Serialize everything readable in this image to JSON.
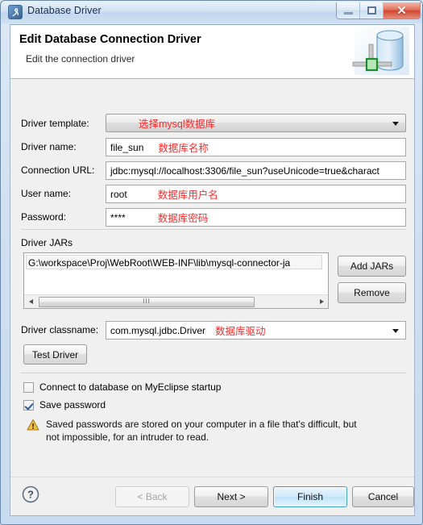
{
  "window": {
    "title": "Database Driver",
    "title_icon": "database-driver-icon",
    "controls": {
      "minimize": "minimize-icon",
      "maximize": "maximize-icon",
      "close": "close-icon"
    }
  },
  "banner": {
    "title": "Edit Database Connection Driver",
    "subtitle": "Edit the connection driver",
    "icon": "database-cylinder-icon"
  },
  "form": {
    "driver_template": {
      "label": "Driver template:",
      "value": "",
      "annotation": "选择mysql数据库"
    },
    "driver_name": {
      "label": "Driver name:",
      "value": "file_sun",
      "annotation": "数据库名称"
    },
    "connection_url": {
      "label": "Connection URL:",
      "value": "jdbc:mysql://localhost:3306/file_sun?useUnicode=true&charact",
      "annotation": ""
    },
    "user_name": {
      "label": "User name:",
      "value": "root",
      "annotation": "数据库用户名"
    },
    "password": {
      "label": "Password:",
      "value": "****",
      "annotation": "数据库密码"
    }
  },
  "driver_jars": {
    "section_label": "Driver JARs",
    "items": [
      "G:\\workspace\\Proj\\WebRoot\\WEB-INF\\lib\\mysql-connector-ja"
    ],
    "add_button": "Add JARs",
    "remove_button": "Remove",
    "scrollbar_grip": "III"
  },
  "driver_classname": {
    "label": "Driver classname:",
    "value": "com.mysql.jdbc.Driver",
    "annotation": "数据库驱动"
  },
  "test_driver_button": "Test Driver",
  "options": {
    "connect_on_startup": {
      "label": "Connect to database on MyEclipse startup",
      "checked": false
    },
    "save_password": {
      "label": "Save password",
      "checked": true
    }
  },
  "warning": {
    "icon": "warning-triangle-icon",
    "text": "Saved passwords are stored on your computer in a file that's difficult, but not impossible, for an intruder to read."
  },
  "footer": {
    "help_icon": "help-question-icon",
    "back_button": "< Back",
    "back_mnemonic": "B",
    "next_button": "Next >",
    "next_mnemonic": "N",
    "finish_button": "Finish",
    "cancel_button": "Cancel"
  },
  "colors": {
    "annotation_red": "#fd2a2a",
    "default_button_border": "#3c9cd4",
    "title_text": "#17304d"
  }
}
